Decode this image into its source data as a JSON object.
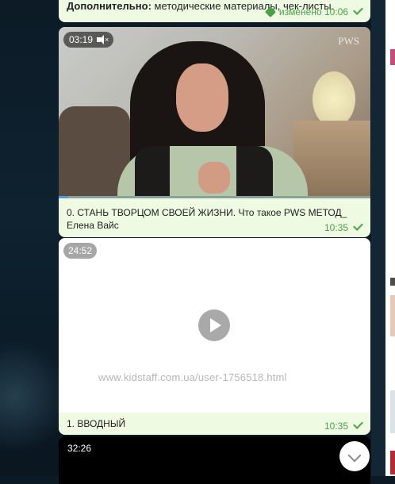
{
  "messages": [
    {
      "text_bold": "Дополнительно:",
      "text": " методические материалы, чек-листы.",
      "status": "изменено 10:06",
      "icon": "pin-icon"
    },
    {
      "video_duration": "03:19",
      "muted": true,
      "watermark": "PWS",
      "caption": "0. СТАНЬ ТВОРЦОМ СВОЕЙ ЖИЗНИ. Что такое PWS МЕТОД_ Елена Вайс",
      "time": "10:35",
      "progress_fraction": 0.03
    },
    {
      "video_duration": "24:52",
      "watermark_url": "www.kidstaff.com.ua/user-1756518.html",
      "caption": "1. ВВОДНЫЙ",
      "time": "10:35"
    },
    {
      "video_duration": "32:26"
    }
  ],
  "icons": {
    "play": "play-icon",
    "mute": "mute-icon",
    "scroll_down": "chevron-down-icon",
    "read": "check-icon"
  }
}
